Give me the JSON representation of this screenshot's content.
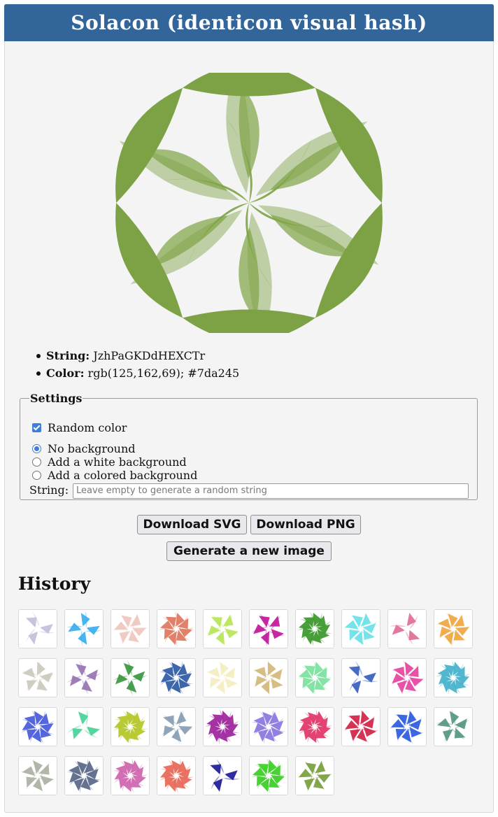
{
  "header": {
    "title": "Solacon (identicon visual hash)"
  },
  "main_image": {
    "color": "#7da245"
  },
  "info": {
    "string_label": "String:",
    "string_value": "JzhPaGKDdHEXCTr",
    "color_label": "Color:",
    "color_value": "rgb(125,162,69); #7da245"
  },
  "settings": {
    "legend": "Settings",
    "random_color_label": "Random color",
    "random_color_checked": true,
    "background_options": [
      {
        "label": "No background",
        "selected": true
      },
      {
        "label": "Add a white background",
        "selected": false
      },
      {
        "label": "Add a colored background",
        "selected": false
      }
    ],
    "string_label": "String:",
    "string_placeholder": "Leave empty to generate a random string"
  },
  "buttons": {
    "download_svg": "Download SVG",
    "download_png": "Download PNG",
    "generate": "Generate a new image"
  },
  "history": {
    "title": "History",
    "items": [
      {
        "color": "#c8c0dc",
        "shape": "3"
      },
      {
        "color": "#3fb0ef",
        "shape": "4"
      },
      {
        "color": "#efc8c0",
        "shape": "6"
      },
      {
        "color": "#e07a62",
        "shape": "8"
      },
      {
        "color": "#b9e65c",
        "shape": "5"
      },
      {
        "color": "#c21f9e",
        "shape": "5"
      },
      {
        "color": "#3f9a2e",
        "shape": "9"
      },
      {
        "color": "#6ee2e8",
        "shape": "7"
      },
      {
        "color": "#e0709a",
        "shape": "3"
      },
      {
        "color": "#f0aa48",
        "shape": "7"
      },
      {
        "color": "#cfcac0",
        "shape": "5"
      },
      {
        "color": "#9b77b4",
        "shape": "4"
      },
      {
        "color": "#3f9a46",
        "shape": "4"
      },
      {
        "color": "#3560a8",
        "shape": "8"
      },
      {
        "color": "#f4eec2",
        "shape": "6"
      },
      {
        "color": "#d4bb7e",
        "shape": "6"
      },
      {
        "color": "#7de2a0",
        "shape": "8"
      },
      {
        "color": "#3b63c0",
        "shape": "3"
      },
      {
        "color": "#e64aa2",
        "shape": "7"
      },
      {
        "color": "#49b3cc",
        "shape": "9"
      },
      {
        "color": "#4c5fdc",
        "shape": "8"
      },
      {
        "color": "#4cd39a",
        "shape": "3"
      },
      {
        "color": "#b5c72a",
        "shape": "9"
      },
      {
        "color": "#8aa0b4",
        "shape": "5"
      },
      {
        "color": "#a0289e",
        "shape": "9"
      },
      {
        "color": "#8d7ae0",
        "shape": "8"
      },
      {
        "color": "#e23a6c",
        "shape": "9"
      },
      {
        "color": "#d32a4c",
        "shape": "7"
      },
      {
        "color": "#3460e0",
        "shape": "7"
      },
      {
        "color": "#5a9a84",
        "shape": "5"
      },
      {
        "color": "#aeb4a4",
        "shape": "6"
      },
      {
        "color": "#5d6a8a",
        "shape": "8"
      },
      {
        "color": "#d068b0",
        "shape": "9"
      },
      {
        "color": "#e86a5a",
        "shape": "9"
      },
      {
        "color": "#24219c",
        "shape": "3"
      },
      {
        "color": "#3fcf2a",
        "shape": "8"
      },
      {
        "color": "#7da245",
        "shape": "6"
      }
    ]
  }
}
